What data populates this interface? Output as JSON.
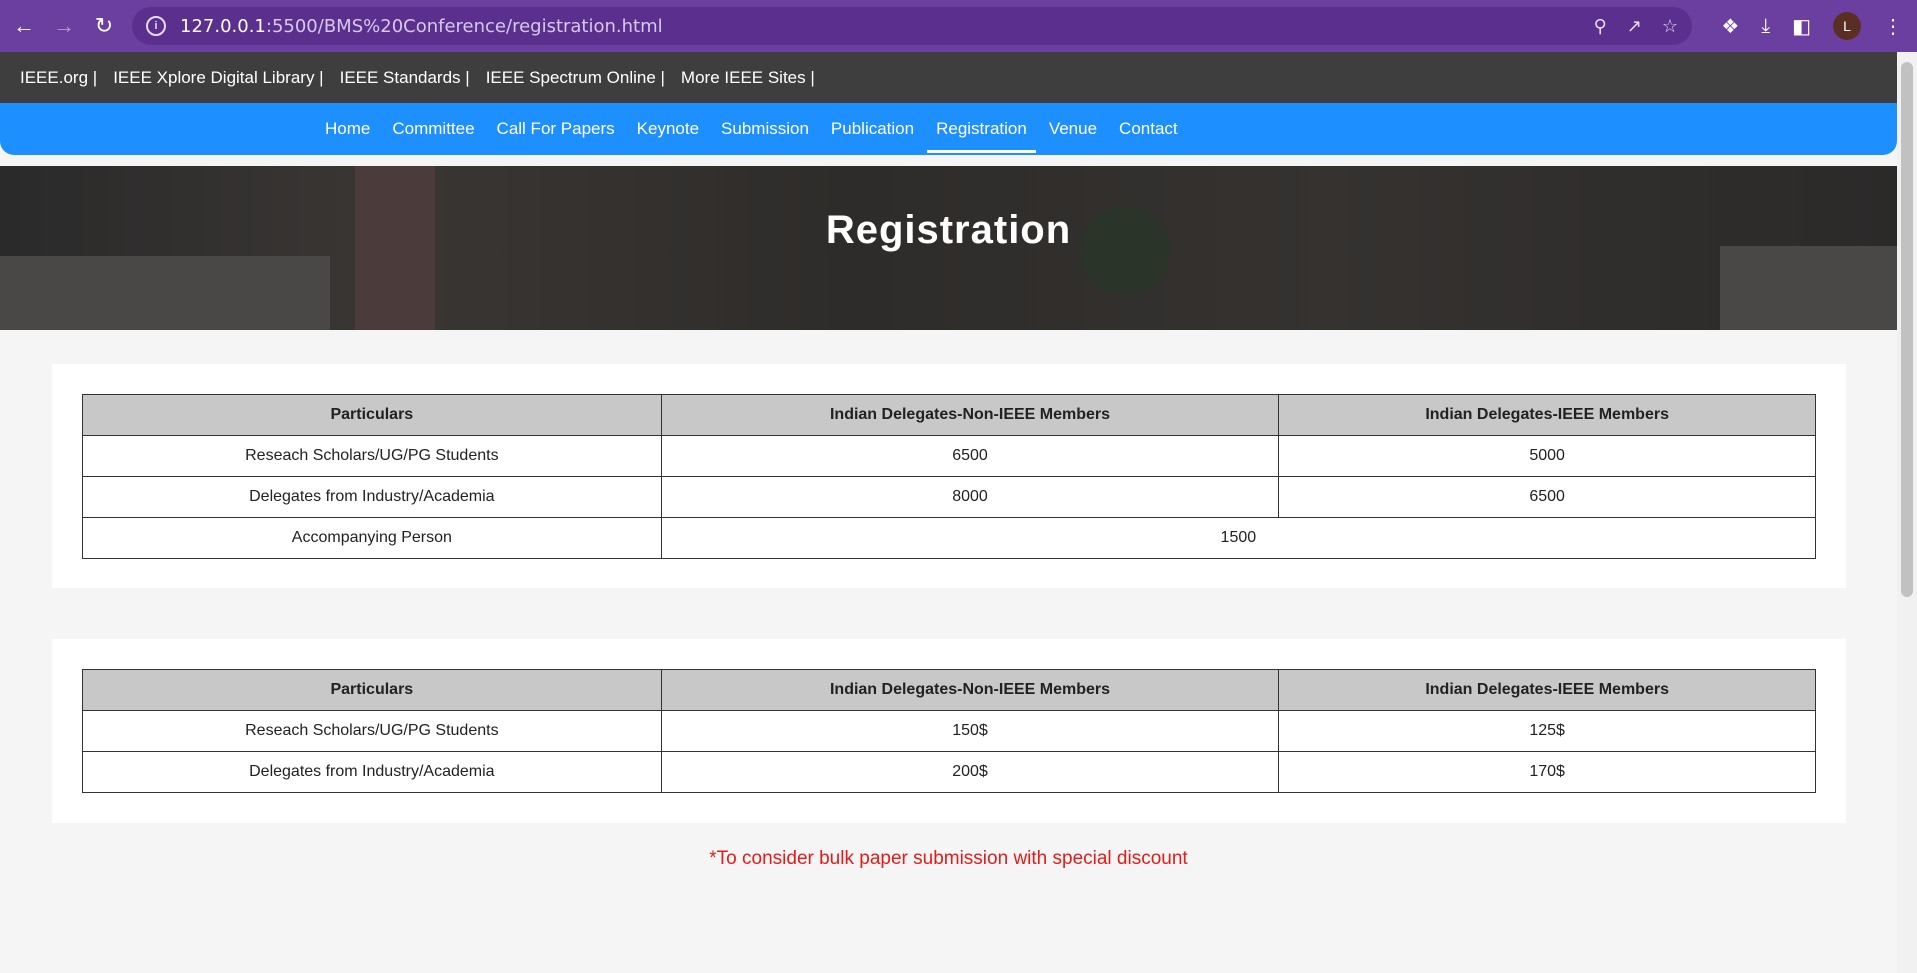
{
  "browser": {
    "url_host": "127.0.0.1",
    "url_path": ":5500/BMS%20Conference/registration.html",
    "avatar_letter": "L"
  },
  "ieee_links": [
    "IEEE.org |",
    "IEEE Xplore Digital Library |",
    "IEEE Standards |",
    "IEEE Spectrum Online |",
    "More IEEE Sites |"
  ],
  "nav": {
    "items": [
      "Home",
      "Committee",
      "Call For Papers",
      "Keynote",
      "Submission",
      "Publication",
      "Registration",
      "Venue",
      "Contact"
    ],
    "active": "Registration"
  },
  "hero": {
    "title": "Registration"
  },
  "table_indian": {
    "headers": [
      "Particulars",
      "Indian Delegates-Non-IEEE Members",
      "Indian Delegates-IEEE Members"
    ],
    "rows": [
      [
        "Reseach Scholars/UG/PG Students",
        "6500",
        "5000"
      ],
      [
        "Delegates from Industry/Academia",
        "8000",
        "6500"
      ]
    ],
    "accompanying": {
      "label": "Accompanying Person",
      "value": "1500"
    }
  },
  "table_foreign": {
    "headers": [
      "Particulars",
      "Indian Delegates-Non-IEEE Members",
      "Indian Delegates-IEEE Members"
    ],
    "rows": [
      [
        "Reseach Scholars/UG/PG Students",
        "150$",
        "125$"
      ],
      [
        "Delegates from Industry/Academia",
        "200$",
        "170$"
      ]
    ]
  },
  "note": "*To consider bulk paper submission with special discount",
  "colors": {
    "browser": "#6a3fa0",
    "nav": "#1e8fff",
    "ieee_bar": "#3e3e3e",
    "note": "#e01c1c"
  }
}
